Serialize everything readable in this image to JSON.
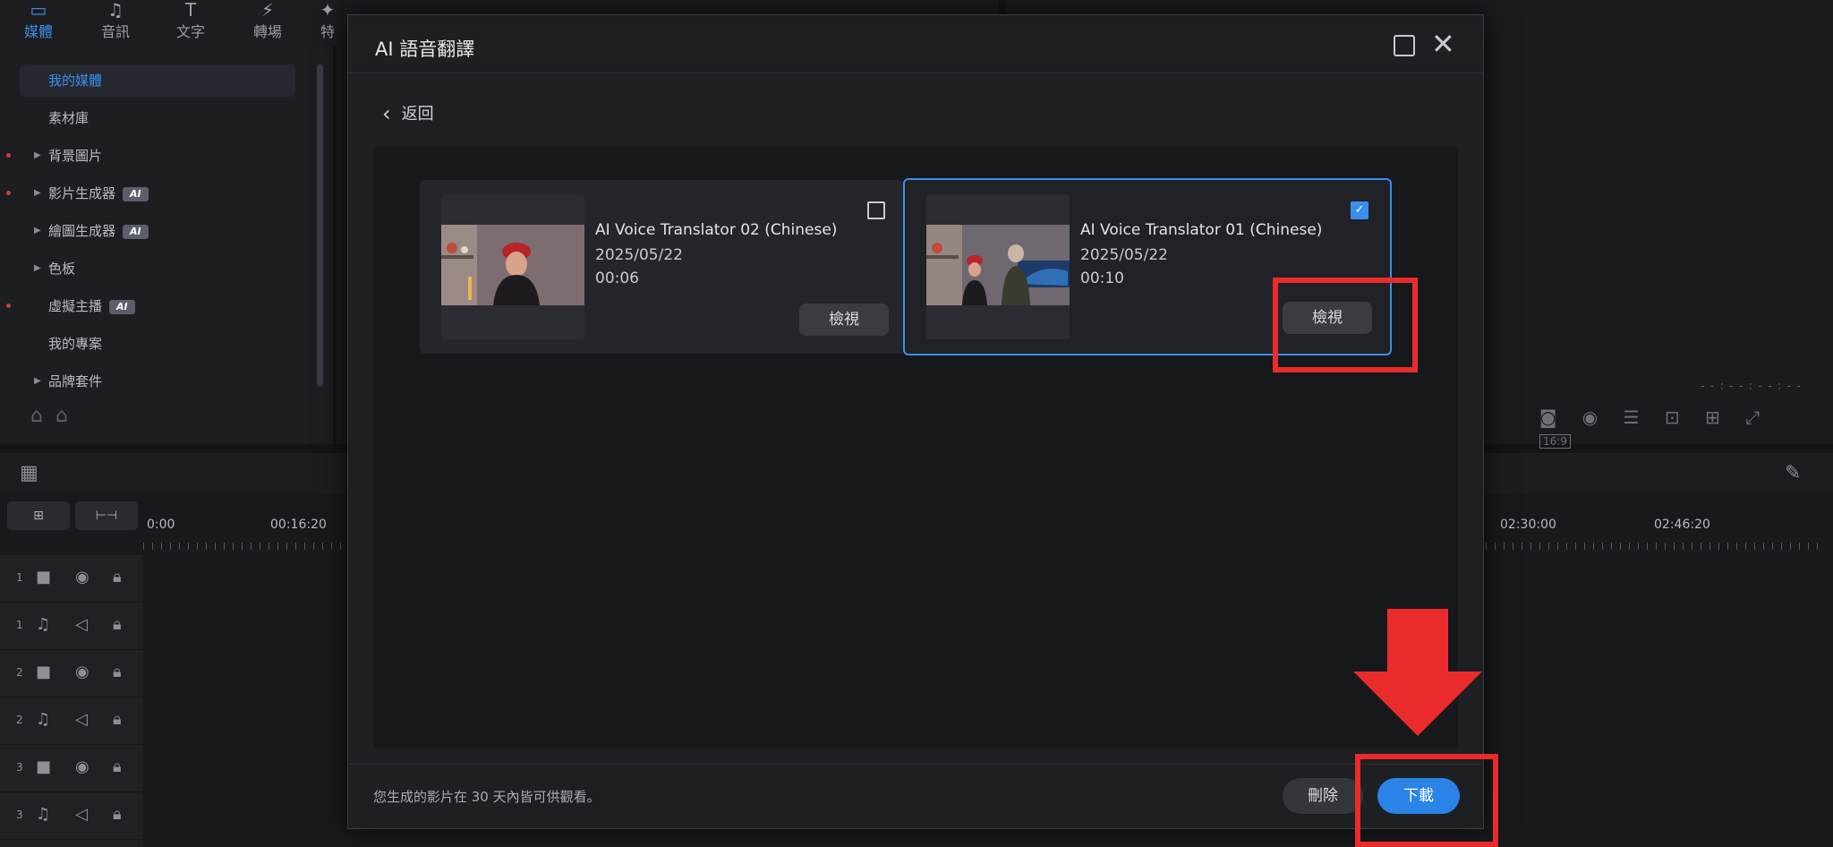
{
  "app": {
    "nav_tabs": [
      {
        "label": "媒體",
        "icon": "media-icon"
      },
      {
        "label": "音訊",
        "icon": "music-note-icon"
      },
      {
        "label": "文字",
        "icon": "text-icon"
      },
      {
        "label": "轉場",
        "icon": "transition-icon"
      },
      {
        "label": "特",
        "icon": "effects-icon"
      }
    ],
    "sidebar": {
      "items": [
        {
          "label": "我的媒體",
          "selected": true
        },
        {
          "label": "素材庫"
        },
        {
          "label": "背景圖片",
          "expandable": true,
          "dot": true
        },
        {
          "label": "影片生成器",
          "expandable": true,
          "dot": true,
          "badge": "AI"
        },
        {
          "label": "繪圖生成器",
          "expandable": true,
          "badge": "AI"
        },
        {
          "label": "色板",
          "expandable": true
        },
        {
          "label": "虛擬主播",
          "dot": true,
          "badge": "AI"
        },
        {
          "label": "我的專案"
        },
        {
          "label": "品牌套件",
          "expandable": true
        }
      ]
    },
    "timeline": {
      "ruler_labels": [
        "0:00",
        "00:16:20",
        "02:30:00",
        "02:46:20"
      ],
      "tracks": [
        "1",
        "1",
        "2",
        "2",
        "3",
        "3"
      ],
      "timecode": "- - : - - : - - : - -"
    },
    "preview": {
      "aspect_label": "16:9"
    }
  },
  "dialog": {
    "title": "AI 語音翻譯",
    "back_label": "返回",
    "cards": [
      {
        "title": "AI Voice Translator 02 (Chinese)",
        "date": "2025/05/22",
        "duration": "00:06",
        "view_label": "檢視",
        "checked": false
      },
      {
        "title": "AI Voice Translator 01 (Chinese)",
        "date": "2025/05/22",
        "duration": "00:10",
        "view_label": "檢視",
        "checked": true
      }
    ],
    "footer_note": "您生成的影片在 30 天內皆可供觀看。",
    "delete_label": "刪除",
    "download_label": "下載"
  },
  "colors": {
    "accent": "#3b8fea",
    "annotation_red": "#ea2b2b",
    "dialog_bg": "#1e1f23"
  }
}
